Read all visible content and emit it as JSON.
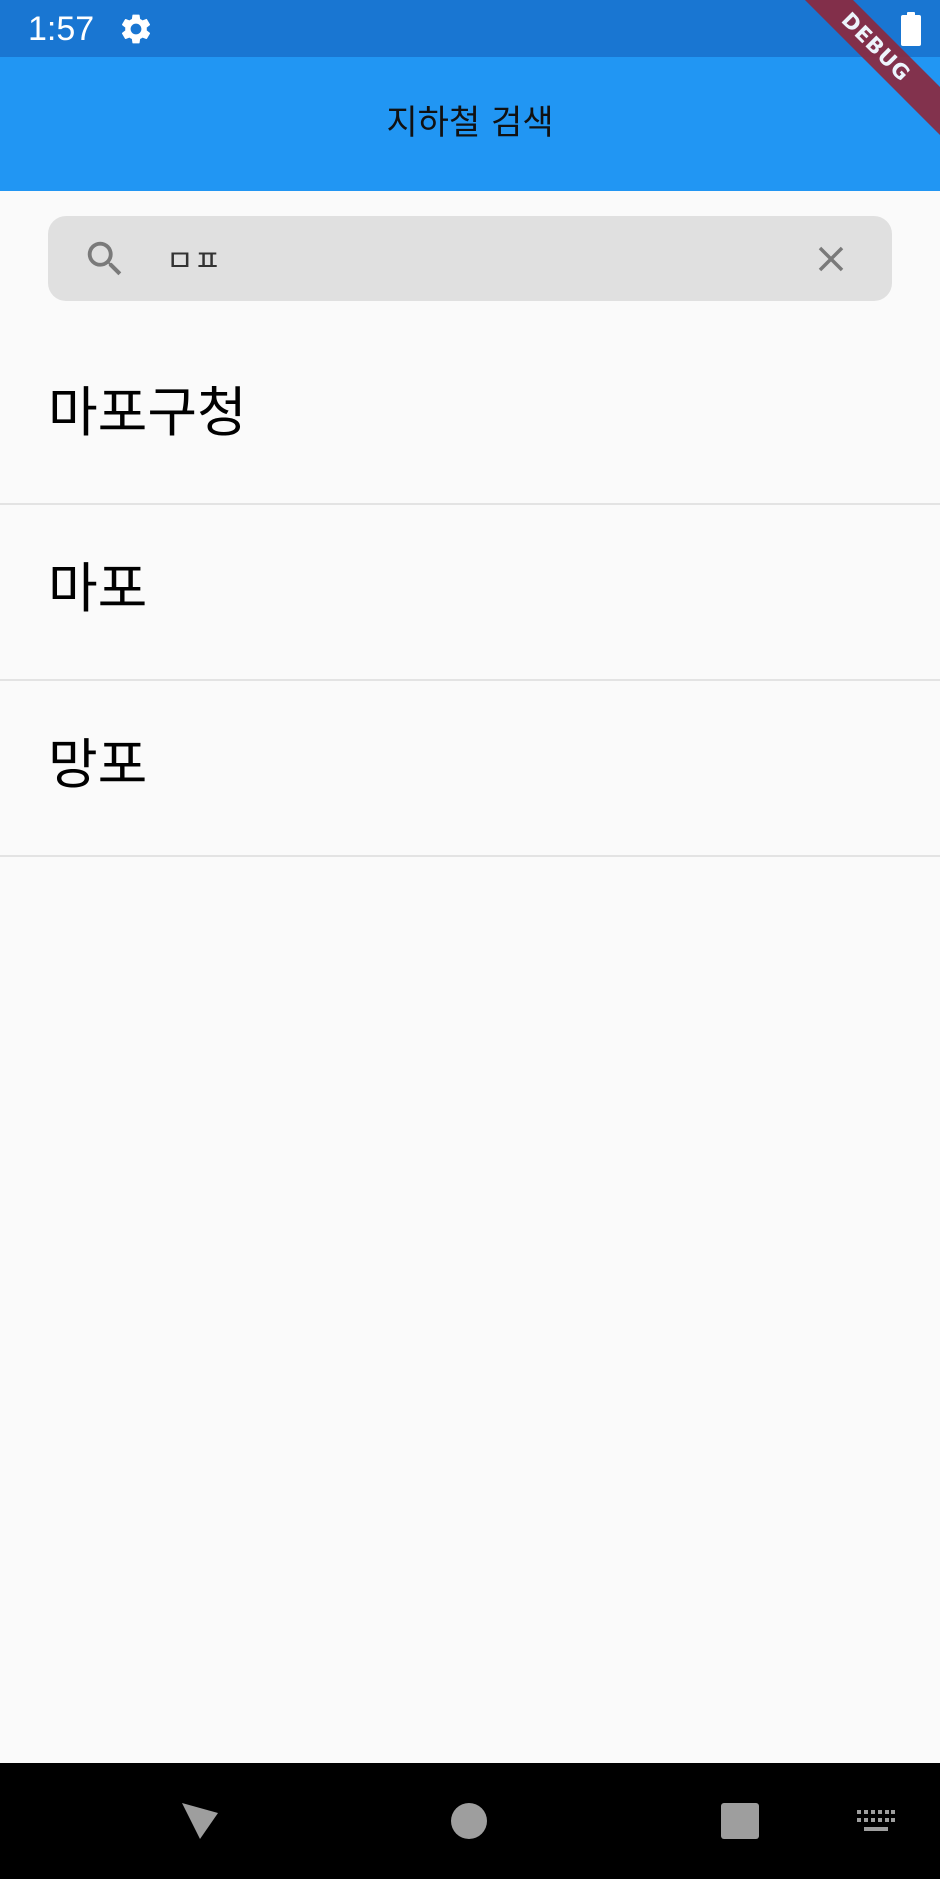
{
  "status_bar": {
    "time": "1:57",
    "settings_icon": "gear-icon",
    "battery_icon": "battery-full-icon"
  },
  "debug_banner": {
    "label": "DEBUG"
  },
  "app_bar": {
    "title": "지하철 검색",
    "background_color": "#2196f3",
    "status_color": "#1976d2"
  },
  "search": {
    "value": "ㅁㅍ",
    "search_icon": "search-icon",
    "clear_icon": "close-icon"
  },
  "results": [
    {
      "label": "마포구청"
    },
    {
      "label": "마포"
    },
    {
      "label": "망포"
    }
  ],
  "nav_bar": {
    "back_icon": "back-triangle-icon",
    "home_icon": "home-circle-icon",
    "recents_icon": "recents-square-icon",
    "keyboard_icon": "keyboard-icon"
  }
}
